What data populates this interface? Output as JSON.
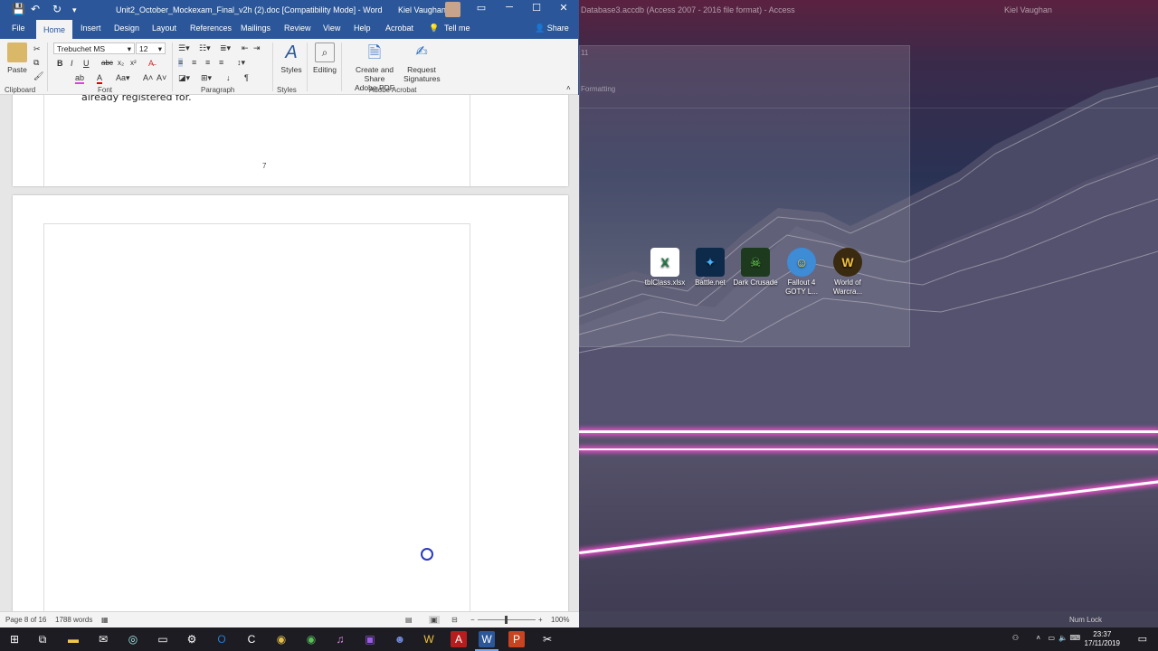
{
  "word": {
    "title": "Unit2_October_Mockexam_Final_v2h (2).doc [Compatibility Mode] - Word",
    "user": "Kiel Vaughan",
    "tabs": [
      "File",
      "Home",
      "Insert",
      "Design",
      "Layout",
      "References",
      "Mailings",
      "Review",
      "View",
      "Help",
      "Acrobat",
      "Tell me"
    ],
    "share": "Share",
    "ribbon": {
      "paste": "Paste",
      "font_name": "Trebuchet MS",
      "font_size": "12",
      "styles": "Styles",
      "editing": "Editing",
      "create_share_pdf_line1": "Create and Share",
      "create_share_pdf_line2": "Adobe PDF",
      "request_sig_line1": "Request",
      "request_sig_line2": "Signatures",
      "groups": {
        "clipboard": "Clipboard",
        "font": "Font",
        "paragraph": "Paragraph",
        "styles": "Styles",
        "acrobat": "Adobe Acrobat"
      },
      "format_buttons": [
        "B",
        "I",
        "U",
        "abc",
        "x₂",
        "x²"
      ]
    },
    "document": {
      "cut_text": "already registered for.",
      "page_number": "7"
    },
    "status": {
      "page": "Page 8 of 16",
      "words": "1788 words",
      "zoom": "100%"
    }
  },
  "desktop": {
    "ghost_title": "Database3.accdb (Access 2007 - 2016 file format)  -  Access",
    "ghost_user": "Kiel Vaughan",
    "ghost_group": "Formatting",
    "ghost_font_size": "11",
    "ghost_status": "Num Lock",
    "icons": [
      {
        "label1": "tblClass.xlsx",
        "label2": "",
        "color": "#1f7a44"
      },
      {
        "label1": "Battle.net",
        "label2": "",
        "color": "#1a8fe0"
      },
      {
        "label1": "Dark Crusade",
        "label2": "",
        "color": "#3aa13a"
      },
      {
        "label1": "Fallout 4",
        "label2": "GOTY L...",
        "color": "#3e8bd6"
      },
      {
        "label1": "World of",
        "label2": "Warcra...",
        "color": "#c58a1c"
      }
    ]
  },
  "taskbar": {
    "time": "23:37",
    "date": "17/11/2019"
  }
}
